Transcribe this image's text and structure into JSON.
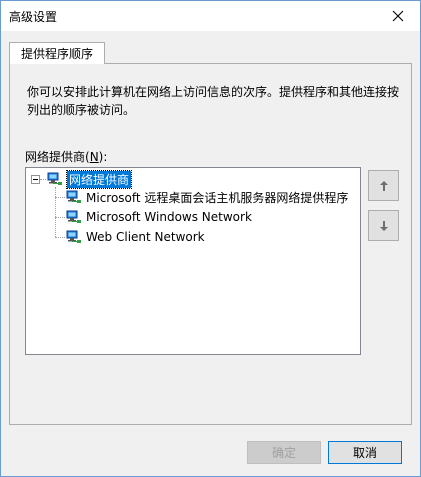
{
  "window": {
    "title": "高级设置"
  },
  "tabs": [
    {
      "label": "提供程序顺序",
      "active": true
    }
  ],
  "panel": {
    "description": "你可以安排此计算机在网络上访问信息的次序。提供程序和其他连接按列出的顺序被访问。",
    "list_label_prefix": "网络提供商(",
    "list_label_accel": "N",
    "list_label_suffix": "):"
  },
  "tree": {
    "root": {
      "label": "网络提供商",
      "selected": true,
      "expanded": true,
      "icon": "network-icon"
    },
    "children": [
      {
        "label": "Microsoft 远程桌面会话主机服务器网络提供程序",
        "icon": "network-icon"
      },
      {
        "label": "Microsoft Windows Network",
        "icon": "network-icon"
      },
      {
        "label": "Web Client Network",
        "icon": "network-icon"
      }
    ]
  },
  "move_buttons": {
    "up_icon": "arrow-up-icon",
    "down_icon": "arrow-down-icon"
  },
  "footer": {
    "ok_label": "确定",
    "ok_disabled": true,
    "cancel_label": "取消"
  },
  "colors": {
    "selection": "#0078d7",
    "window_border": "#6b9bd1",
    "background": "#f0f0f0"
  }
}
